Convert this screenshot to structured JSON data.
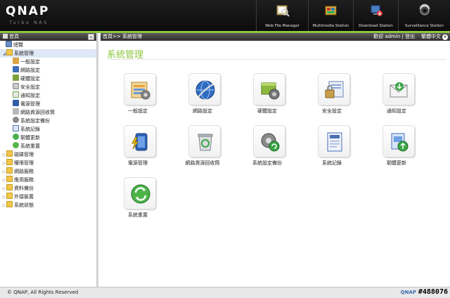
{
  "header": {
    "logo": "QNAP",
    "logo_sub": "Turbo NAS",
    "apps": [
      {
        "label": "Web File Manager",
        "icon": "web-file-manager-icon"
      },
      {
        "label": "Multimedia Station",
        "icon": "multimedia-station-icon"
      },
      {
        "label": "Download Station",
        "icon": "download-station-icon"
      },
      {
        "label": "Surveillance Station",
        "icon": "surveillance-station-icon"
      }
    ]
  },
  "sidebar": {
    "title": "首頁",
    "collapse": "«",
    "items": [
      {
        "label": "總覽",
        "level": "top",
        "icon": "overview-icon"
      },
      {
        "label": "系統管理",
        "level": "0",
        "icon": "folder-open-icon",
        "expanded": true,
        "selected": true
      },
      {
        "label": "一般設定",
        "level": "1",
        "icon": "general-settings-icon"
      },
      {
        "label": "網路設定",
        "level": "1",
        "icon": "network-settings-icon"
      },
      {
        "label": "硬體設定",
        "level": "1",
        "icon": "hardware-settings-icon"
      },
      {
        "label": "安全設定",
        "level": "1",
        "icon": "security-settings-icon"
      },
      {
        "label": "通知設定",
        "level": "1",
        "icon": "notification-settings-icon"
      },
      {
        "label": "電源管理",
        "level": "1",
        "icon": "power-management-icon"
      },
      {
        "label": "網路資源回收筒",
        "level": "1",
        "icon": "network-recycle-bin-icon"
      },
      {
        "label": "系統設定備份",
        "level": "1",
        "icon": "system-backup-icon"
      },
      {
        "label": "系統記錄",
        "level": "1",
        "icon": "system-logs-icon"
      },
      {
        "label": "韌體更新",
        "level": "1",
        "icon": "firmware-update-icon"
      },
      {
        "label": "系統重置",
        "level": "1",
        "icon": "system-reset-icon"
      },
      {
        "label": "磁碟管理",
        "level": "0",
        "icon": "folder-icon"
      },
      {
        "label": "權限管理",
        "level": "0",
        "icon": "folder-icon"
      },
      {
        "label": "網路服務",
        "level": "0",
        "icon": "folder-icon"
      },
      {
        "label": "應用服務",
        "level": "0",
        "icon": "folder-icon"
      },
      {
        "label": "資料備份",
        "level": "0",
        "icon": "folder-icon"
      },
      {
        "label": "外接裝置",
        "level": "0",
        "icon": "folder-icon"
      },
      {
        "label": "系統狀態",
        "level": "0",
        "icon": "folder-icon"
      }
    ]
  },
  "main": {
    "breadcrumb": "首頁>> 系統管理",
    "welcome": "歡迎 admin",
    "separator": "|",
    "logout": "登出",
    "language": "繁體中文",
    "language_arrow": "▾",
    "title": "系統管理",
    "tiles": [
      {
        "label": "一般設定",
        "icon": "general-settings-icon"
      },
      {
        "label": "網路設定",
        "icon": "network-settings-icon"
      },
      {
        "label": "硬體設定",
        "icon": "hardware-settings-icon"
      },
      {
        "label": "安全設定",
        "icon": "security-settings-icon"
      },
      {
        "label": "通知設定",
        "icon": "notification-settings-icon"
      },
      {
        "label": "電源管理",
        "icon": "power-management-icon"
      },
      {
        "label": "網路資源回收筒",
        "icon": "network-recycle-bin-icon"
      },
      {
        "label": "系統設定備份",
        "icon": "system-backup-icon"
      },
      {
        "label": "系統記錄",
        "icon": "system-logs-icon"
      },
      {
        "label": "韌體更新",
        "icon": "firmware-update-icon"
      },
      {
        "label": "系統重置",
        "icon": "system-reset-icon"
      }
    ]
  },
  "footer": {
    "copyright": "© QNAP, All Rights Reserved",
    "logo": "QNAP",
    "watermark": "#488076"
  },
  "colors": {
    "accent_green": "#8dc63f",
    "header_bg": "#141414",
    "selected_bg": "#dfe8f6"
  }
}
